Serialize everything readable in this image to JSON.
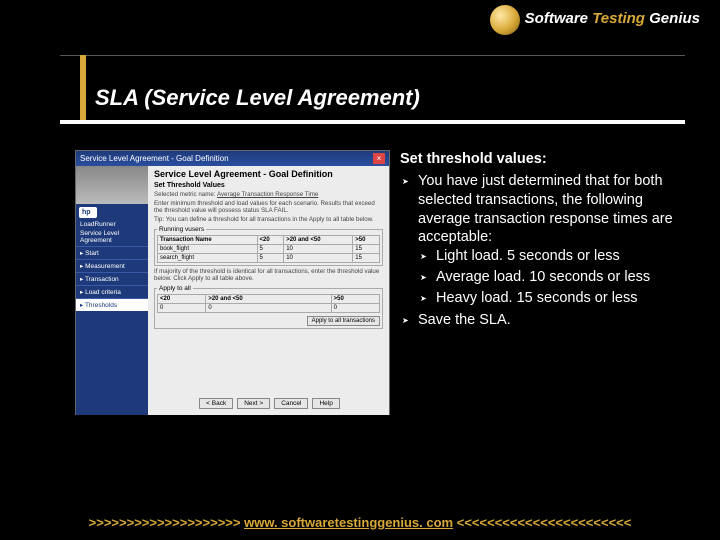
{
  "logo": {
    "w1": "Software",
    "w2": "Testing",
    "w3": "Genius"
  },
  "title": "SLA (Service Level Agreement)",
  "dialog": {
    "title": "Service Level Agreement - Goal Definition",
    "heading": "Service Level Agreement - Goal Definition",
    "sub": "Set Threshold Values",
    "goal_label": "Selected metric name:",
    "goal_value": "Average Transaction Response Time",
    "desc1": "Enter minimum threshold and load values for each scenario. Results that exceed the threshold value will possess status SLA FAIL.",
    "desc2": "Tip: You can define a threshold for all transactions in the Apply to all table below.",
    "side_brand": "LoadRunner",
    "side_title": "Service Level Agreement",
    "side_items": [
      "Start",
      "Measurement",
      "Transaction",
      "Load criteria",
      "Thresholds"
    ],
    "group1": "Running vusers",
    "th": [
      "Transaction Name",
      "<20",
      ">20 and <50",
      ">50"
    ],
    "rows": [
      [
        "book_flight",
        "5",
        "10",
        "15"
      ],
      [
        "search_flight",
        "5",
        "10",
        "15"
      ]
    ],
    "desc3": "If majority of the threshold is identical for all transactions, enter the threshold value below. Click Apply to all table above.",
    "group2": "Apply to all",
    "row2h": [
      "<20",
      ">20 and <50",
      ">50"
    ],
    "row2": [
      "0",
      "0",
      "0"
    ],
    "apply": "Apply to all transactions",
    "buttons": [
      "< Back",
      "Next >",
      "Cancel",
      "Help"
    ]
  },
  "content": {
    "lead": "Set threshold values:",
    "b1": "You have just determined that for both selected transactions, the following average transaction response times are acceptable:",
    "sub": [
      "Light load. 5 seconds or less",
      "Average load. 10 seconds or less",
      "Heavy load. 15 seconds or less"
    ],
    "b2": "Save the SLA."
  },
  "footer": {
    "left": ">>>>>>>>>>>>>>>>>>>>",
    "link": "www. softwaretestinggenius. com",
    "right": "<<<<<<<<<<<<<<<<<<<<<<<"
  }
}
